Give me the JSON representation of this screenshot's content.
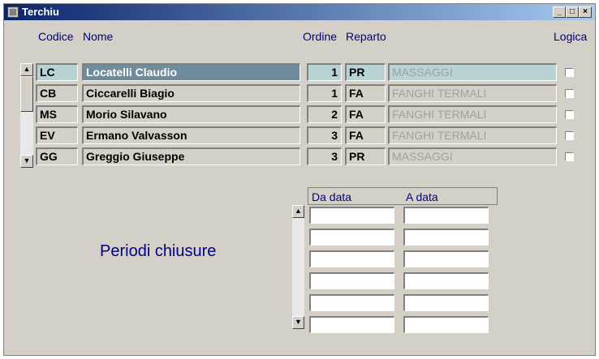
{
  "window": {
    "title": "Terchiu"
  },
  "headers": {
    "codice": "Codice",
    "nome": "Nome",
    "ordine": "Ordine",
    "reparto": "Reparto",
    "logica": "Logica"
  },
  "rows": [
    {
      "codice": "LC",
      "nome": "Locatelli Claudio",
      "ordine": "1",
      "reparto": "PR",
      "reparto_desc": "MASSAGGI",
      "logica": false
    },
    {
      "codice": "CB",
      "nome": "Ciccarelli Biagio",
      "ordine": "1",
      "reparto": "FA",
      "reparto_desc": "FANGHI TERMALI",
      "logica": false
    },
    {
      "codice": "MS",
      "nome": "Morio Silavano",
      "ordine": "2",
      "reparto": "FA",
      "reparto_desc": "FANGHI TERMALI",
      "logica": false
    },
    {
      "codice": "EV",
      "nome": "Ermano Valvasson",
      "ordine": "3",
      "reparto": "FA",
      "reparto_desc": "FANGHI TERMALI",
      "logica": false
    },
    {
      "codice": "GG",
      "nome": "Greggio Giuseppe",
      "ordine": "3",
      "reparto": "PR",
      "reparto_desc": "MASSAGGI",
      "logica": false
    }
  ],
  "periodi": {
    "label": "Periodi chiusure",
    "da_data": "Da data",
    "a_data": "A data",
    "rows": [
      {
        "da": "",
        "a": ""
      },
      {
        "da": "",
        "a": ""
      },
      {
        "da": "",
        "a": ""
      },
      {
        "da": "",
        "a": ""
      },
      {
        "da": "",
        "a": ""
      },
      {
        "da": "",
        "a": ""
      }
    ]
  },
  "colors": {
    "titlebar_start": "#0a246a",
    "titlebar_end": "#a6caf0",
    "selected_row": "#b9d2d3",
    "selected_name": "#6f8b9c",
    "header_text": "#000080",
    "label_text": "#00008b"
  }
}
